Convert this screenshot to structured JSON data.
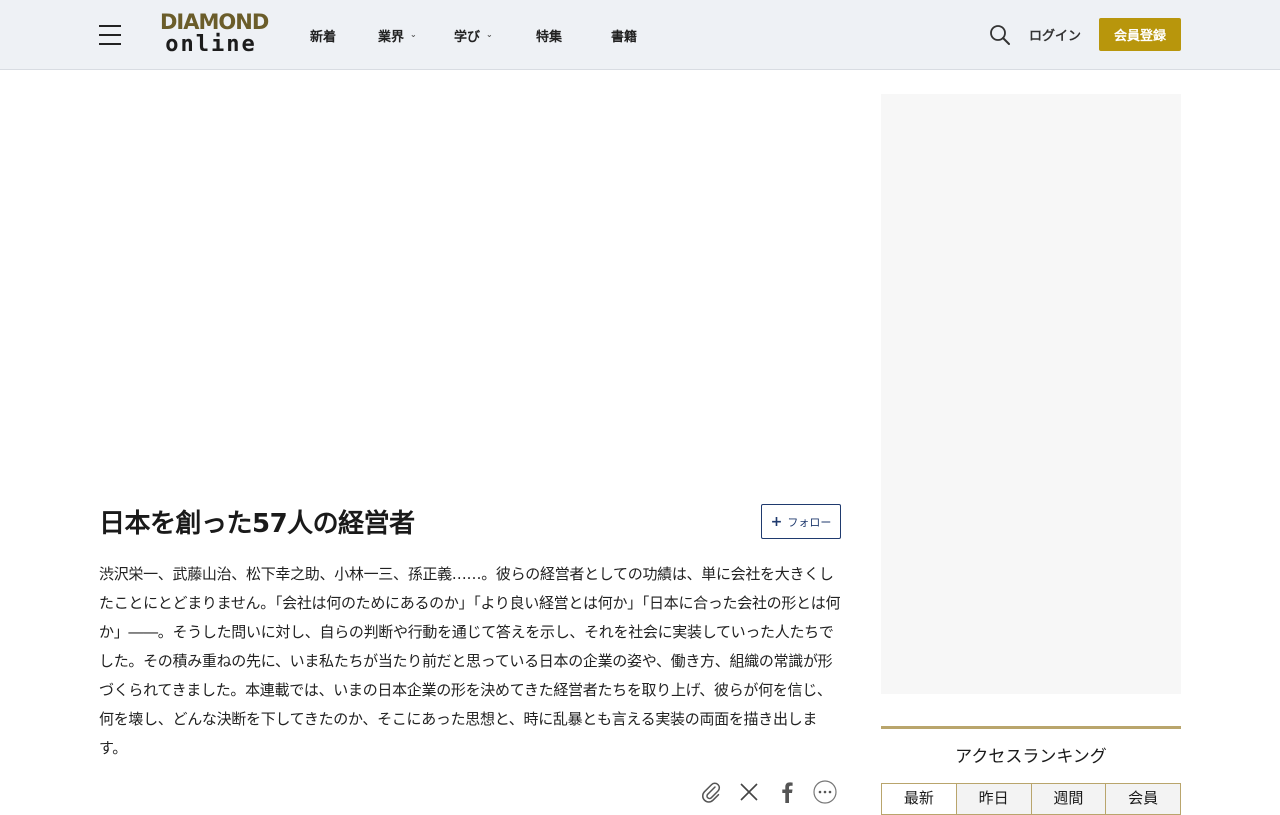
{
  "header": {
    "logo_top": "DIAMOND",
    "logo_bottom": "online",
    "nav": [
      {
        "label": "新着",
        "has_dropdown": false
      },
      {
        "label": "業界",
        "has_dropdown": true
      },
      {
        "label": "学び",
        "has_dropdown": true
      },
      {
        "label": "特集",
        "has_dropdown": false
      },
      {
        "label": "書籍",
        "has_dropdown": false
      }
    ],
    "login_label": "ログイン",
    "register_label": "会員登録"
  },
  "article": {
    "title": "日本を創った57人の経営者",
    "follow_label": "フォロー",
    "body": "渋沢栄一、武藤山治、松下幸之助、小林一三、孫正義……。彼らの経営者としての功績は、単に会社を大きくしたことにとどまりません。「会社は何のためにあるのか」「より良い経営とは何か」「日本に合った会社の形とは何か」――。そうした問いに対し、自らの判断や行動を通じて答えを示し、それを社会に実装していった人たちでした。その積み重ねの先に、いま私たちが当たり前だと思っている日本の企業の姿や、働き方、組織の常識が形づくられてきました。本連載では、いまの日本企業の形を決めてきた経営者たちを取り上げ、彼らが何を信じ、何を壊し、どんな決断を下してきたのか、そこにあった思想と、時に乱暴とも言える実装の両面を描き出します。"
  },
  "share_icons": [
    "paperclip-icon",
    "x-icon",
    "facebook-icon",
    "more-icon"
  ],
  "ranking": {
    "title": "アクセスランキング",
    "tabs": [
      "最新",
      "昨日",
      "週間",
      "会員"
    ],
    "active_tab": 0
  },
  "colors": {
    "accent_gold": "#b8960c",
    "header_bg": "#eef1f5",
    "follow_blue": "#1f3a6e",
    "ranking_rule": "#b9a56c"
  }
}
